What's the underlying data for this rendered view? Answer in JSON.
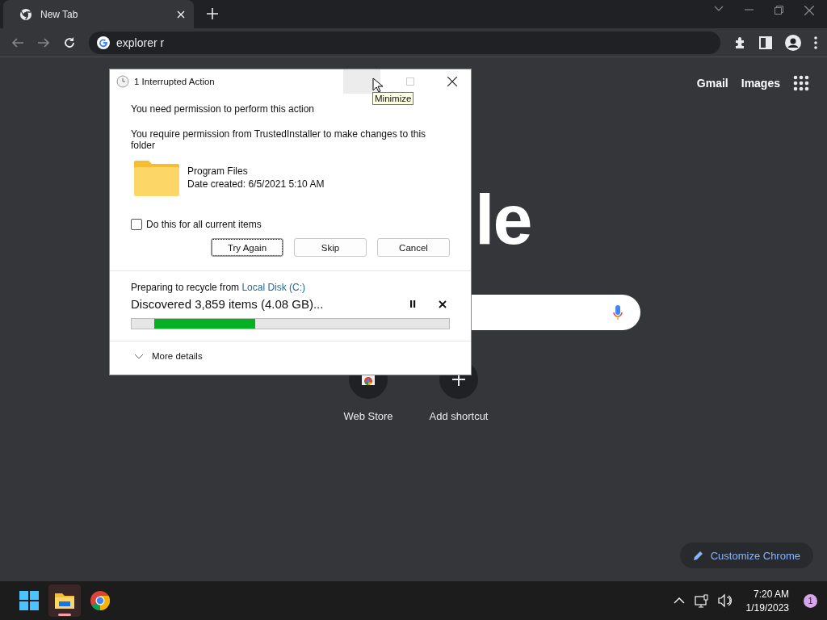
{
  "browser": {
    "tab": {
      "title": "New Tab",
      "selected": true
    },
    "address": "explorer r"
  },
  "new_tab_page": {
    "links": [
      "Gmail",
      "Images"
    ],
    "logo_fragment": "le",
    "shortcuts": [
      {
        "label": "Web Store",
        "kind": "store"
      },
      {
        "label": "Add shortcut",
        "kind": "add"
      }
    ],
    "customize": "Customize Chrome"
  },
  "dialog": {
    "title": "1 Interrupted Action",
    "tooltip": "Minimize",
    "heading": "You need permission to perform this action",
    "message": "You require permission from TrustedInstaller to make changes to this folder",
    "item": {
      "name": "Program Files",
      "date": "Date created: 6/5/2021 5:10 AM"
    },
    "checkbox": {
      "label": "Do this for all current items",
      "checked": false
    },
    "buttons": [
      {
        "label": "Try Again",
        "focused": true
      },
      {
        "label": "Skip",
        "focused": false
      },
      {
        "label": "Cancel",
        "focused": false
      }
    ],
    "progress": {
      "prefix": "Preparing to recycle from",
      "source": "Local Disk (C:)",
      "status": "Discovered 3,859 items (4.08 GB)..."
    },
    "details": {
      "label": "More details",
      "expanded": false
    }
  },
  "taskbar": {
    "apps": [
      {
        "kind": "start",
        "active": false
      },
      {
        "kind": "explorer",
        "active": true
      },
      {
        "kind": "chrome",
        "active": false
      }
    ],
    "time": "7:20 AM",
    "date": "1/19/2023",
    "notifications": "1"
  }
}
